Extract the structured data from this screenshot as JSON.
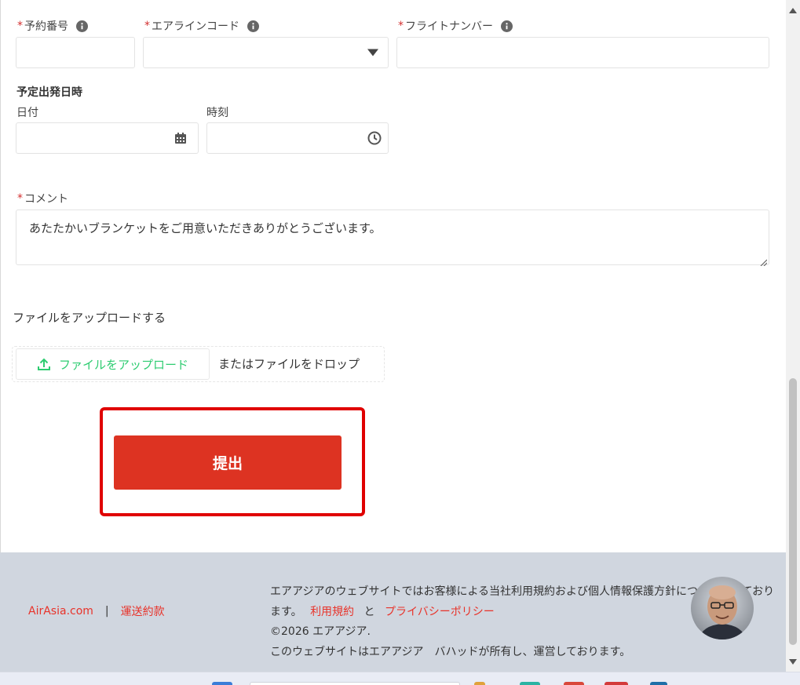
{
  "form": {
    "reservation_number": {
      "required_mark": "*",
      "label": "予約番号",
      "value": ""
    },
    "airline_code": {
      "required_mark": "*",
      "label": "エアラインコード",
      "value": ""
    },
    "flight_number": {
      "required_mark": "*",
      "label": "フライトナンバー",
      "value": ""
    },
    "departure": {
      "title": "予定出発日時",
      "date_label": "日付",
      "date_value": "",
      "time_label": "時刻",
      "time_value": ""
    },
    "comment": {
      "required_mark": "*",
      "label": "コメント",
      "value": "あたたかいブランケットをご用意いただきありがとうございます。"
    },
    "upload": {
      "title": "ファイルをアップロードする",
      "button_label": "ファイルをアップロード",
      "drop_text": "またはファイルをドロップ"
    },
    "submit_label": "提出"
  },
  "footer": {
    "links": [
      "AirAsia.com",
      "運送約款"
    ],
    "separator": "|",
    "text_line1": "エアアジアのウェブサイトではお客様による当社利用規約および個人情報保護方針についって定めております。",
    "policy_prefix": "エアアジアのウェブサイトではお客様による当社利用規約および個人情報保護方針について定めております。",
    "terms_link": "利用規約",
    "and": "と",
    "privacy_link": "プライバシーポリシー",
    "copyright": "©2026 エアアジア.",
    "ownership": "このウェブサイトはエアアジア　バハッドが所有し、運営しております。"
  },
  "colors": {
    "required": "#d32f2f",
    "submit": "#dd3322",
    "highlight": "#e00000",
    "upload_accent": "#2ecc71",
    "footer_bg": "#d0d6df",
    "footer_link": "#e8332a"
  },
  "icons": [
    "info-icon",
    "dropdown-arrow-icon",
    "calendar-icon",
    "clock-icon",
    "upload-icon",
    "avatar"
  ]
}
